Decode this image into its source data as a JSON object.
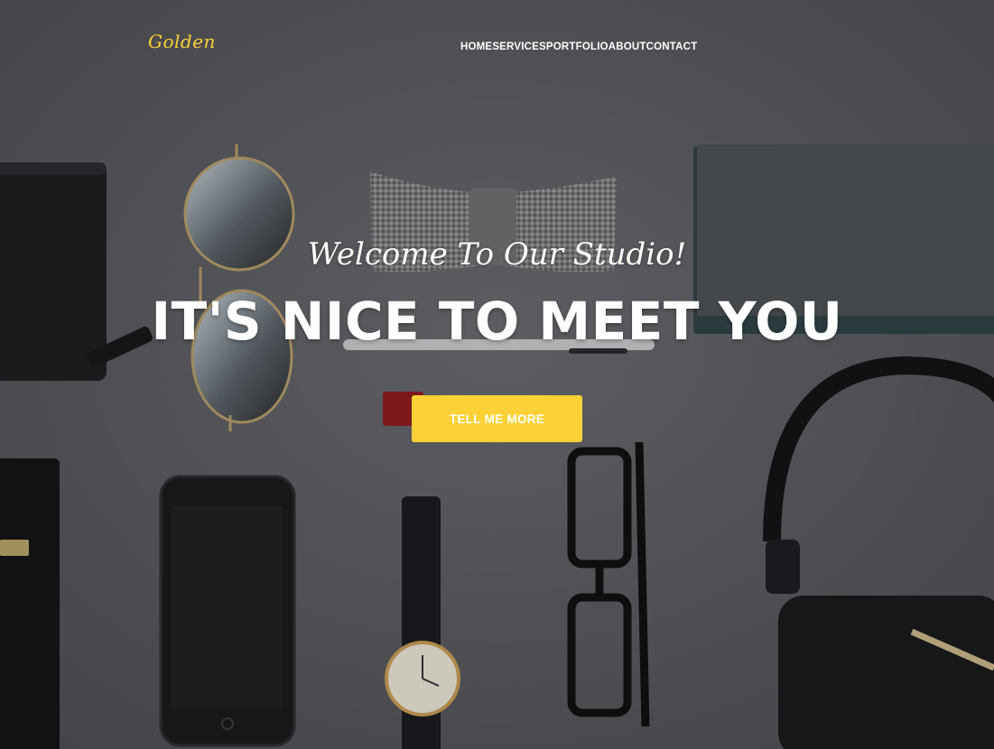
{
  "nav": {
    "brand": "Golden",
    "links": [
      "HOME",
      "SERVICES",
      "PORTFOLIO",
      "ABOUT",
      "CONTACT"
    ]
  },
  "hero": {
    "lead_in": "Welcome To Our Studio!",
    "heading": "IT'S NICE TO MEET YOU",
    "cta_label": "TELL ME MORE",
    "background": "flat-lay photo of accessories: wallets, aviator sunglasses, bow tie, notebook, pen, lighter, smartphone, wristwatch, eyeglasses, headphones on grey surface"
  },
  "colors": {
    "accent": "#fed136",
    "text": "#ffffff",
    "background": "#5c5d62"
  }
}
